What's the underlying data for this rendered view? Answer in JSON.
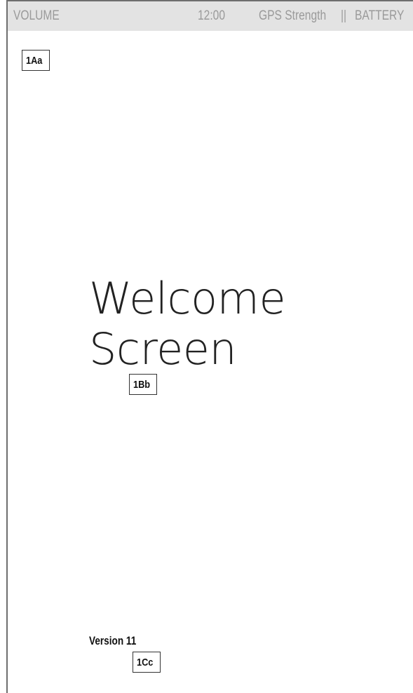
{
  "status_bar": {
    "volume": "VOLUME",
    "time": "12:00",
    "gps": "GPS Strength",
    "separator": "||",
    "battery": "BATTERY"
  },
  "annotations": {
    "tag_1": "1Aa",
    "tag_2": "1Bb",
    "tag_3": "1Cc"
  },
  "welcome": {
    "title": "Welcome Screen"
  },
  "footer": {
    "version": "Version 11"
  }
}
